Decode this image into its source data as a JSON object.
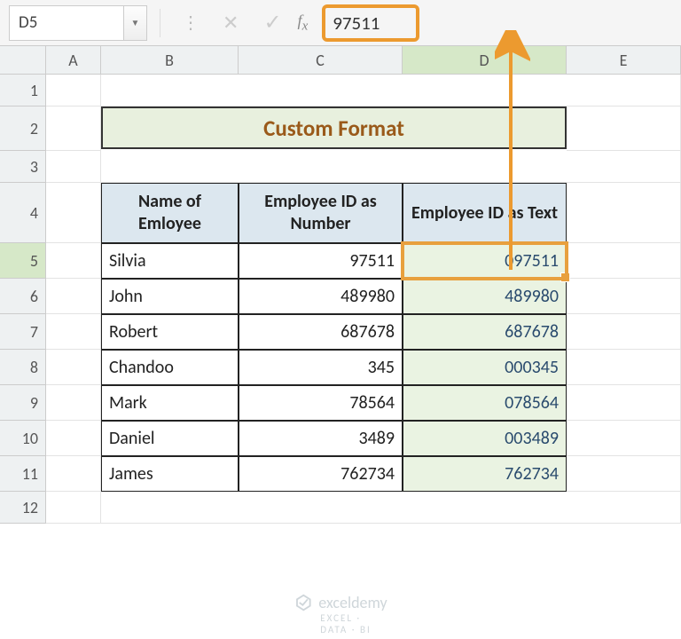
{
  "name_box": "D5",
  "formula_value": "97511",
  "columns": [
    "A",
    "B",
    "C",
    "D",
    "E"
  ],
  "rows": [
    "1",
    "2",
    "3",
    "4",
    "5",
    "6",
    "7",
    "8",
    "9",
    "10",
    "11",
    "12"
  ],
  "title": "Custom Format",
  "headers": {
    "name": "Name of Emloyee",
    "id_num": "Employee ID as Number",
    "id_text": "Employee ID as Text"
  },
  "data": [
    {
      "name": "Silvia",
      "num": "97511",
      "text": "097511"
    },
    {
      "name": "John",
      "num": "489980",
      "text": "489980"
    },
    {
      "name": "Robert",
      "num": "687678",
      "text": "687678"
    },
    {
      "name": "Chandoo",
      "num": "345",
      "text": "000345"
    },
    {
      "name": "Mark",
      "num": "78564",
      "text": "078564"
    },
    {
      "name": "Daniel",
      "num": "3489",
      "text": "003489"
    },
    {
      "name": "James",
      "num": "762734",
      "text": "762734"
    }
  ],
  "watermark": {
    "brand": "exceldemy",
    "tag": "EXCEL · DATA · BI"
  },
  "selected": {
    "row": 5,
    "col": "D"
  }
}
